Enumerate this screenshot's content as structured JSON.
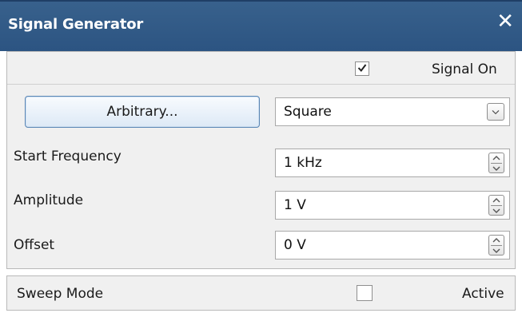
{
  "window": {
    "title": "Signal Generator",
    "close_icon": "close-icon"
  },
  "signal": {
    "on_label": "Signal On",
    "on_checked": true
  },
  "controls": {
    "arbitrary_button": "Arbitrary...",
    "waveform": {
      "selected": "Square"
    },
    "start_frequency": {
      "label": "Start Frequency",
      "value": "1 kHz"
    },
    "amplitude": {
      "label": "Amplitude",
      "value": "1 V"
    },
    "offset": {
      "label": "Offset",
      "value": "0 V"
    }
  },
  "sweep": {
    "label": "Sweep Mode",
    "active_label": "Active",
    "active_checked": false
  }
}
